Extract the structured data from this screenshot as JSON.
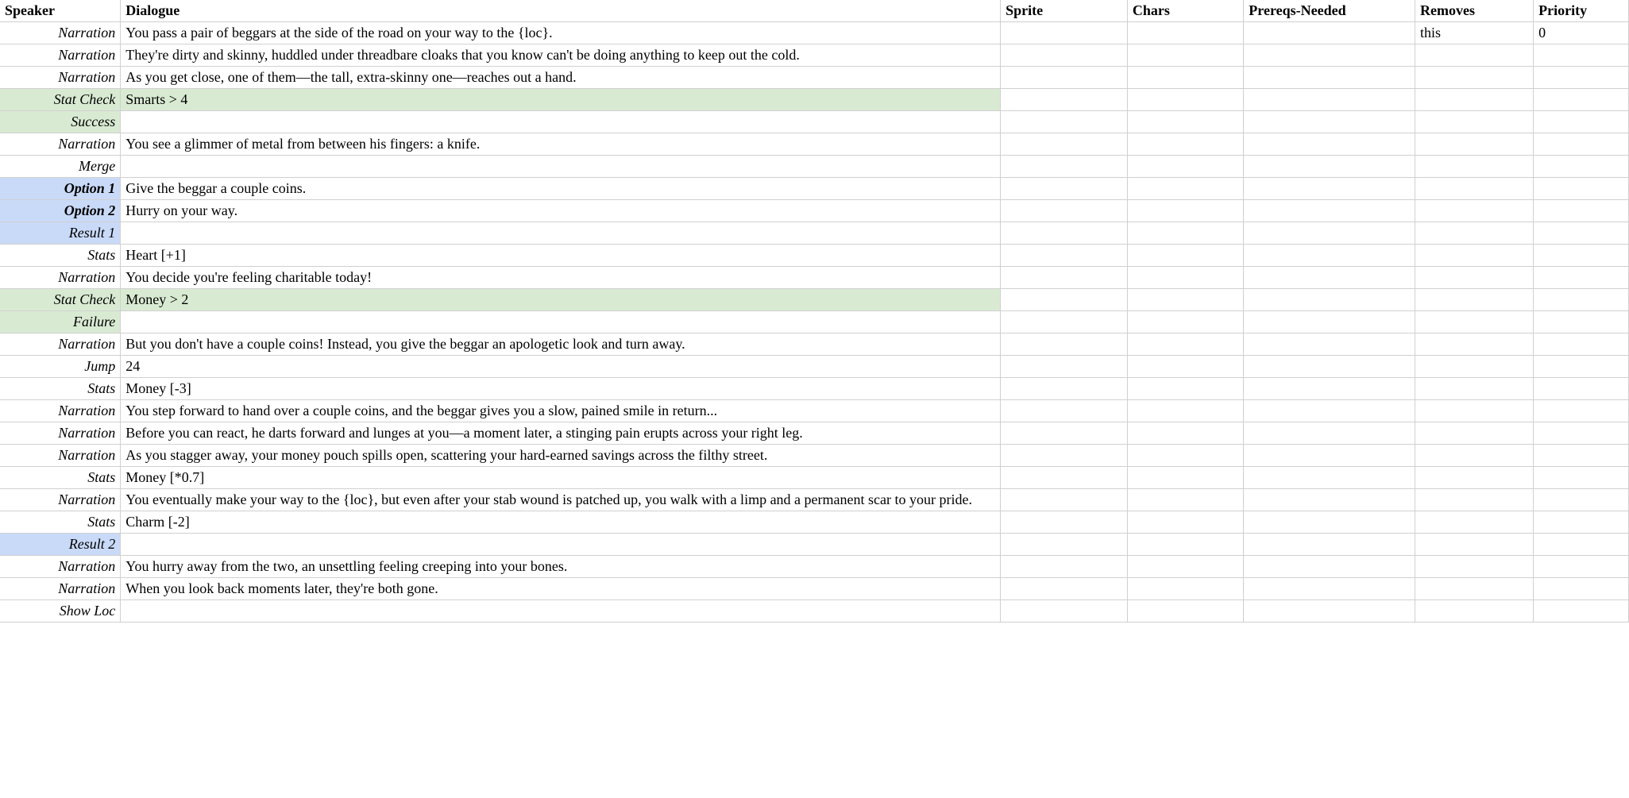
{
  "headers": {
    "speaker": "Speaker",
    "dialogue": "Dialogue",
    "sprite": "Sprite",
    "chars": "Chars",
    "prereqs": "Prereqs-Needed",
    "removes": "Removes",
    "priority": "Priority"
  },
  "rows": [
    {
      "speaker": "Narration",
      "dialogue": "You pass a pair of beggars at the side of the road on your way to the {loc}.",
      "removes": "this",
      "priority": "0",
      "style": ""
    },
    {
      "speaker": "Narration",
      "dialogue": "They're dirty and skinny, huddled under threadbare cloaks that you know can't be doing anything to keep out the cold.",
      "style": ""
    },
    {
      "speaker": "Narration",
      "dialogue": "As you get close, one of them—the tall, extra-skinny one—reaches out a hand.",
      "style": ""
    },
    {
      "speaker": "Stat Check",
      "dialogue": "Smarts > 4",
      "style": "green"
    },
    {
      "speaker": "Success",
      "dialogue": "",
      "style": "green-speaker"
    },
    {
      "speaker": "Narration",
      "dialogue": "You see a glimmer of metal from between his fingers: a knife.",
      "style": ""
    },
    {
      "speaker": "Merge",
      "dialogue": "",
      "style": ""
    },
    {
      "speaker": "Option 1",
      "dialogue": "Give the beggar a couple coins.",
      "style": "blue-bold"
    },
    {
      "speaker": "Option 2",
      "dialogue": "Hurry on your way.",
      "style": "blue-bold"
    },
    {
      "speaker": "Result 1",
      "dialogue": "",
      "style": "blue"
    },
    {
      "speaker": "Stats",
      "dialogue": "Heart [+1]",
      "style": ""
    },
    {
      "speaker": "Narration",
      "dialogue": "You decide you're feeling charitable today!",
      "style": ""
    },
    {
      "speaker": "Stat Check",
      "dialogue": "Money > 2",
      "style": "green"
    },
    {
      "speaker": "Failure",
      "dialogue": "",
      "style": "green-speaker"
    },
    {
      "speaker": "Narration",
      "dialogue": "But you don't have a couple coins! Instead, you give the beggar an apologetic look and turn away.",
      "style": ""
    },
    {
      "speaker": "Jump",
      "dialogue": "24",
      "style": ""
    },
    {
      "speaker": "Stats",
      "dialogue": "Money [-3]",
      "style": ""
    },
    {
      "speaker": "Narration",
      "dialogue": "You step forward to hand over a couple coins, and the beggar gives you a slow, pained smile in return...",
      "style": ""
    },
    {
      "speaker": "Narration",
      "dialogue": "Before you can react, he darts forward and lunges at you—a moment later, a stinging pain erupts across your right leg.",
      "style": ""
    },
    {
      "speaker": "Narration",
      "dialogue": "As you stagger away, your money pouch spills open, scattering your hard-earned savings across the filthy street.",
      "style": ""
    },
    {
      "speaker": "Stats",
      "dialogue": "Money [*0.7]",
      "style": ""
    },
    {
      "speaker": "Narration",
      "dialogue": "You eventually make your way to the {loc}, but even after your stab wound is patched up, you walk with a limp and a permanent scar to your pride.",
      "style": ""
    },
    {
      "speaker": "Stats",
      "dialogue": "Charm [-2]",
      "style": ""
    },
    {
      "speaker": "Result 2",
      "dialogue": "",
      "style": "blue"
    },
    {
      "speaker": "Narration",
      "dialogue": "You hurry away from the two, an unsettling feeling creeping into your bones.",
      "style": ""
    },
    {
      "speaker": "Narration",
      "dialogue": "When you look back moments later, they're both gone.",
      "style": ""
    },
    {
      "speaker": "Show Loc",
      "dialogue": "",
      "style": ""
    }
  ]
}
